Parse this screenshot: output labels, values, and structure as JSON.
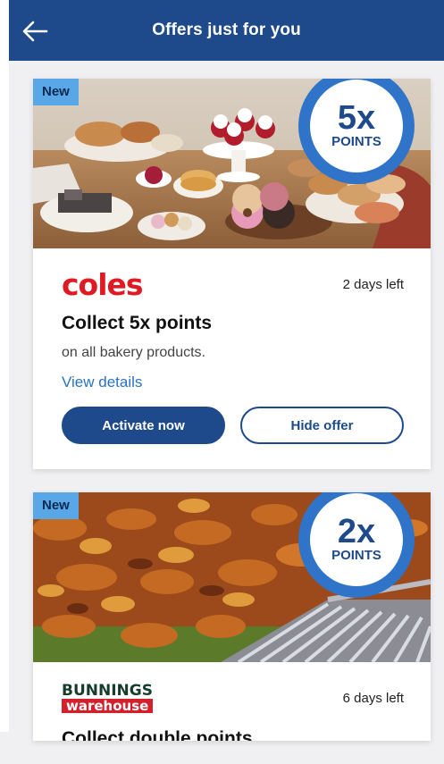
{
  "header": {
    "title": "Offers just for you"
  },
  "offers": [
    {
      "badge": "New",
      "points_multiplier": "5x",
      "points_word": "POINTS",
      "brand": "coles",
      "days_left": "2 days left",
      "title": "Collect 5x points",
      "subtitle": "on all bakery products.",
      "details_link": "View details",
      "primary_button": "Activate now",
      "secondary_button": "Hide offer"
    },
    {
      "badge": "New",
      "points_multiplier": "2x",
      "points_word": "POINTS",
      "brand_top": "BUNNINGS",
      "brand_bottom": "warehouse",
      "days_left": "6 days left",
      "title": "Collect double points"
    }
  ],
  "colors": {
    "primary": "#1e4a8c",
    "accent": "#2f74c8",
    "badge": "#5aa7e8",
    "coles_red": "#e01a22",
    "link": "#2a72c4"
  }
}
